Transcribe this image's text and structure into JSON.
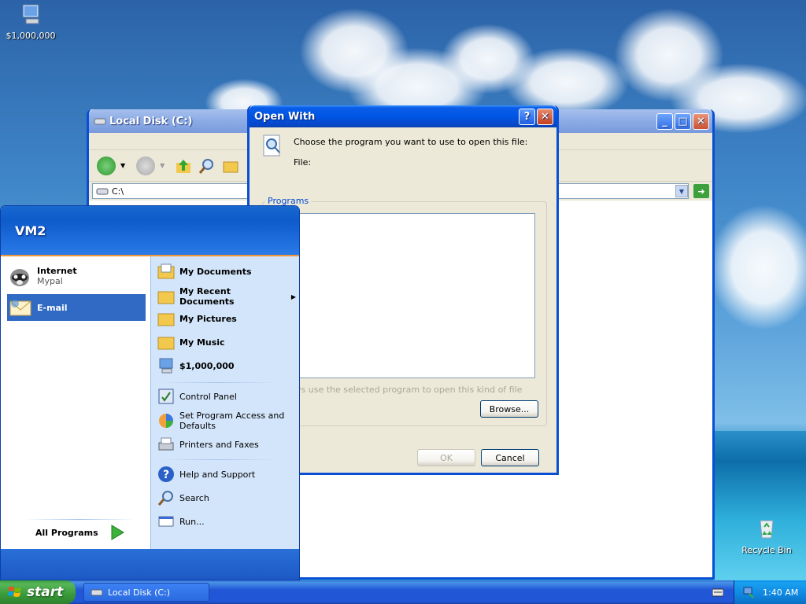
{
  "desktop": {
    "icons": [
      {
        "label": "$1,000,000"
      },
      {
        "label": "Recycle Bin"
      }
    ]
  },
  "explorer": {
    "title": "Local Disk (C:)",
    "address": "C:\\"
  },
  "dialog": {
    "title": "Open With",
    "prompt": "Choose the program you want to use to open this file:",
    "file_label": "File:",
    "programs_legend": "Programs",
    "always_use": "ys use the selected program to open this kind of file",
    "browse": "Browse...",
    "ok": "OK",
    "cancel": "Cancel"
  },
  "startmenu": {
    "user": "VM2",
    "pinned": [
      {
        "title": "Internet",
        "subtitle": "Mypal"
      },
      {
        "title": "E-mail"
      }
    ],
    "all_programs": "All Programs",
    "places": [
      "My Documents",
      "My Recent Documents",
      "My Pictures",
      "My Music",
      "$1,000,000"
    ],
    "settings": [
      "Control Panel",
      "Set Program Access and Defaults",
      "Printers and Faxes"
    ],
    "help": [
      "Help and Support",
      "Search",
      "Run..."
    ]
  },
  "taskbar": {
    "start": "start",
    "task": "Local Disk (C:)",
    "clock": "1:40 AM"
  },
  "colors": {
    "xp_blue": "#0055e5",
    "start_green": "#3a9a3a",
    "selected_item": "#316ac5"
  }
}
